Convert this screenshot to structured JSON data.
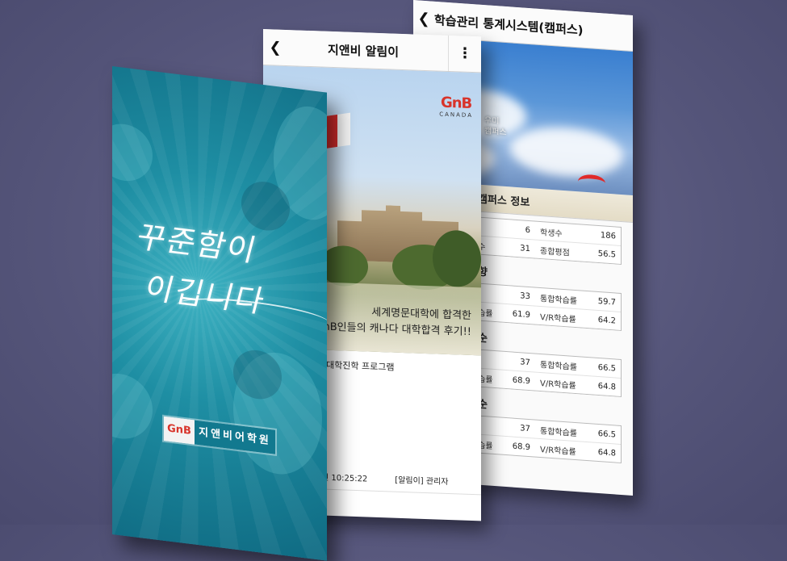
{
  "stats_screen": {
    "title": "학습관리 통계시스템(캠퍼스)",
    "banner_text": [
      "우미",
      "캠퍼스"
    ],
    "section_campus": "캠퍼스 정보",
    "campus_rows": [
      {
        "lab1": "수",
        "v1": "6",
        "lab2": "학생수",
        "v2": "186"
      },
      {
        "lab1": "소수",
        "v1": "31",
        "lab2": "종합평점",
        "v2": "56.5"
      }
    ],
    "sections": [
      {
        "title": "향",
        "rows": [
          {
            "lab1": "수",
            "v1": "33",
            "lab2": "통합학습률",
            "v2": "59.7"
          },
          {
            "lab1": "학습률",
            "v1": "61.9",
            "lab2": "V/R학습률",
            "v2": "64.2"
          }
        ]
      },
      {
        "title": "순",
        "rows": [
          {
            "lab1": "수",
            "v1": "37",
            "lab2": "통합학습률",
            "v2": "66.5"
          },
          {
            "lab1": "학습률",
            "v1": "68.9",
            "lab2": "V/R학습률",
            "v2": "64.8"
          }
        ]
      },
      {
        "title": "순",
        "rows": [
          {
            "lab1": "수",
            "v1": "37",
            "lab2": "통합학습률",
            "v2": "66.5"
          },
          {
            "lab1": "학습률",
            "v1": "68.9",
            "lab2": "V/R학습률",
            "v2": "64.8"
          }
        ]
      }
    ]
  },
  "notice_screen": {
    "title": "지앤비 알림이",
    "logo_main": "GnB",
    "logo_sub": "CANADA",
    "caption_line1": "세계명문대학에 합격한",
    "caption_line2": "nB인들의 캐나다 대학합격 후기!!",
    "item": "대학진학 프로그램",
    "footer_time": "전 10:25:22",
    "footer_author": "[알림이] 관리자"
  },
  "splash_screen": {
    "slogan_line1": "꾸준함이",
    "slogan_line2": "이깁니다",
    "brand_logo": "GnB",
    "brand_name": "지앤비어학원"
  },
  "colors": {
    "background": "#55557a",
    "splash_teal": "#1e8ea3",
    "brand_red": "#d8342b",
    "brand_green": "#2d9e3d"
  }
}
